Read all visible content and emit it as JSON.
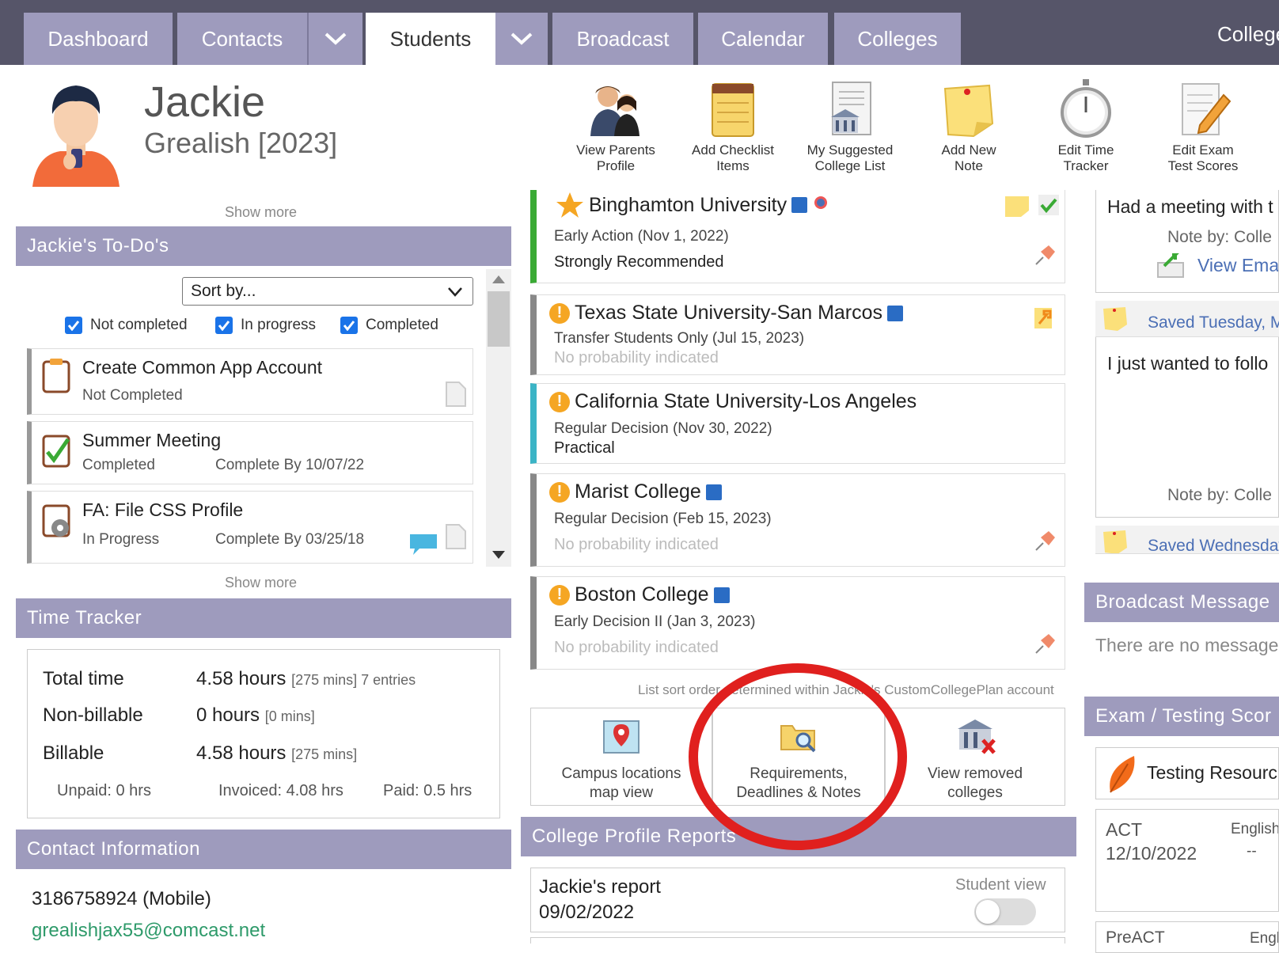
{
  "nav": {
    "tabs": [
      "Dashboard",
      "Contacts",
      "Students",
      "Broadcast",
      "Calendar",
      "Colleges"
    ],
    "brand": "College"
  },
  "student": {
    "first_name": "Jackie",
    "last_name_year": "Grealish [2023]"
  },
  "toolbar": [
    {
      "label1": "View Parents",
      "label2": "Profile",
      "icon": "parents-icon"
    },
    {
      "label1": "Add Checklist",
      "label2": "Items",
      "icon": "checklist-icon"
    },
    {
      "label1": "My Suggested",
      "label2": "College List",
      "icon": "suggested-list-icon"
    },
    {
      "label1": "Add New",
      "label2": "Note",
      "icon": "note-icon"
    },
    {
      "label1": "Edit Time",
      "label2": "Tracker",
      "icon": "stopwatch-icon"
    },
    {
      "label1": "Edit Exam",
      "label2": "Test Scores",
      "icon": "exam-edit-icon"
    }
  ],
  "todos": {
    "show_more_top": "Show more",
    "header": "Jackie's To-Do's",
    "sort_placeholder": "Sort by...",
    "filters": [
      "Not completed",
      "In progress",
      "Completed"
    ],
    "items": [
      {
        "title": "Create Common App Account",
        "status": "Not Completed",
        "due": ""
      },
      {
        "title": "Summer Meeting",
        "status": "Completed",
        "due": "Complete By 10/07/22"
      },
      {
        "title": "FA: File CSS Profile",
        "status": "In Progress",
        "due": "Complete By 03/25/18"
      }
    ],
    "show_more_bottom": "Show more"
  },
  "time_tracker": {
    "header": "Time Tracker",
    "total_label": "Total time",
    "total_value": "4.58 hours",
    "total_detail": "[275 mins] 7 entries",
    "nonbill_label": "Non-billable",
    "nonbill_value": "0 hours",
    "nonbill_detail": "[0 mins]",
    "bill_label": "Billable",
    "bill_value": "4.58 hours",
    "bill_detail": "[275 mins]",
    "unpaid": "Unpaid: 0 hrs",
    "invoiced": "Invoiced: 4.08 hrs",
    "paid": "Paid: 0.5 hrs"
  },
  "contact": {
    "header": "Contact Information",
    "phone": "3186758924 (Mobile)",
    "email": "grealishjax55@comcast.net"
  },
  "colleges": [
    {
      "name": "Binghamton University",
      "deadline": "Early Action (Nov 1, 2022)",
      "probability": "Strongly Recommended",
      "color": "#3aaa35"
    },
    {
      "name": "Texas State University-San Marcos",
      "deadline": "Transfer Students Only (Jul 15, 2023)",
      "probability": "No probability indicated",
      "color": "#888888"
    },
    {
      "name": "California State University-Los Angeles",
      "deadline": "Regular Decision (Nov 30, 2022)",
      "probability": "Practical",
      "color": "#3bb4c6"
    },
    {
      "name": "Marist College",
      "deadline": "Regular Decision (Feb 15, 2023)",
      "probability": "No probability indicated",
      "color": "#888888"
    },
    {
      "name": "Boston College",
      "deadline": "Early Decision II (Jan 3, 2023)",
      "probability": "No probability indicated",
      "color": "#888888"
    }
  ],
  "college_actions": {
    "sort_note": "List sort order determined within Jackie's CustomCollegePlan account",
    "map1": "Campus locations",
    "map2": "map view",
    "req1": "Requirements,",
    "req2": "Deadlines & Notes",
    "removed1": "View removed",
    "removed2": "colleges"
  },
  "reports": {
    "header": "College Profile Reports",
    "title": "Jackie's report",
    "date": "09/02/2022",
    "student_view": "Student view"
  },
  "notes": {
    "note1_text": "Had a meeting with t",
    "note1_by": "Note by: Colle",
    "note1_link": "View Ema",
    "saved1": "Saved Tuesday, M",
    "note2_text": "I just wanted to follo",
    "note2_by": "Note by: Colle",
    "saved2": "Saved Wednesday"
  },
  "broadcast": {
    "header": "Broadcast Message",
    "empty": "There are no message"
  },
  "exams": {
    "header": "Exam / Testing Scor",
    "resources": "Testing Resourc",
    "act_label": "ACT",
    "act_date": "12/10/2022",
    "act_col": "English",
    "act_val": "--",
    "preact_label": "PreACT",
    "preact_col": "Engl"
  },
  "colors": {
    "nav_bg": "#565569",
    "tab_bg": "#9e9bbd",
    "highlight_circle": "#e0201e"
  }
}
